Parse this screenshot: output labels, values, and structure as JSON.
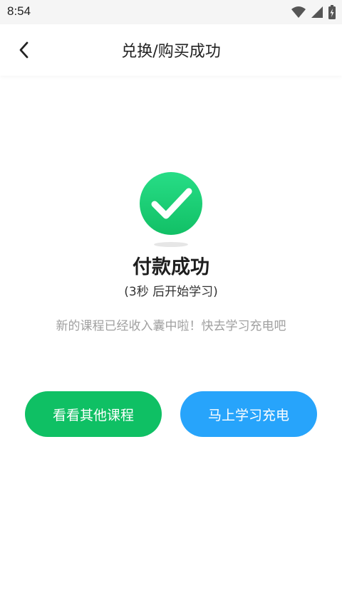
{
  "status_bar": {
    "time": "8:54"
  },
  "nav": {
    "title": "兑换/购买成功"
  },
  "result": {
    "title": "付款成功",
    "countdown_prefix": "(",
    "countdown_seconds": "3",
    "countdown_text": "秒 后开始学习)",
    "message": "新的课程已经收入囊中啦！快去学习充电吧"
  },
  "buttons": {
    "browse_label": "看看其他课程",
    "start_label": "马上学习充电"
  },
  "colors": {
    "success_green": "#1fd27a",
    "browse_button": "#0fc064",
    "start_button": "#27a4fb"
  }
}
